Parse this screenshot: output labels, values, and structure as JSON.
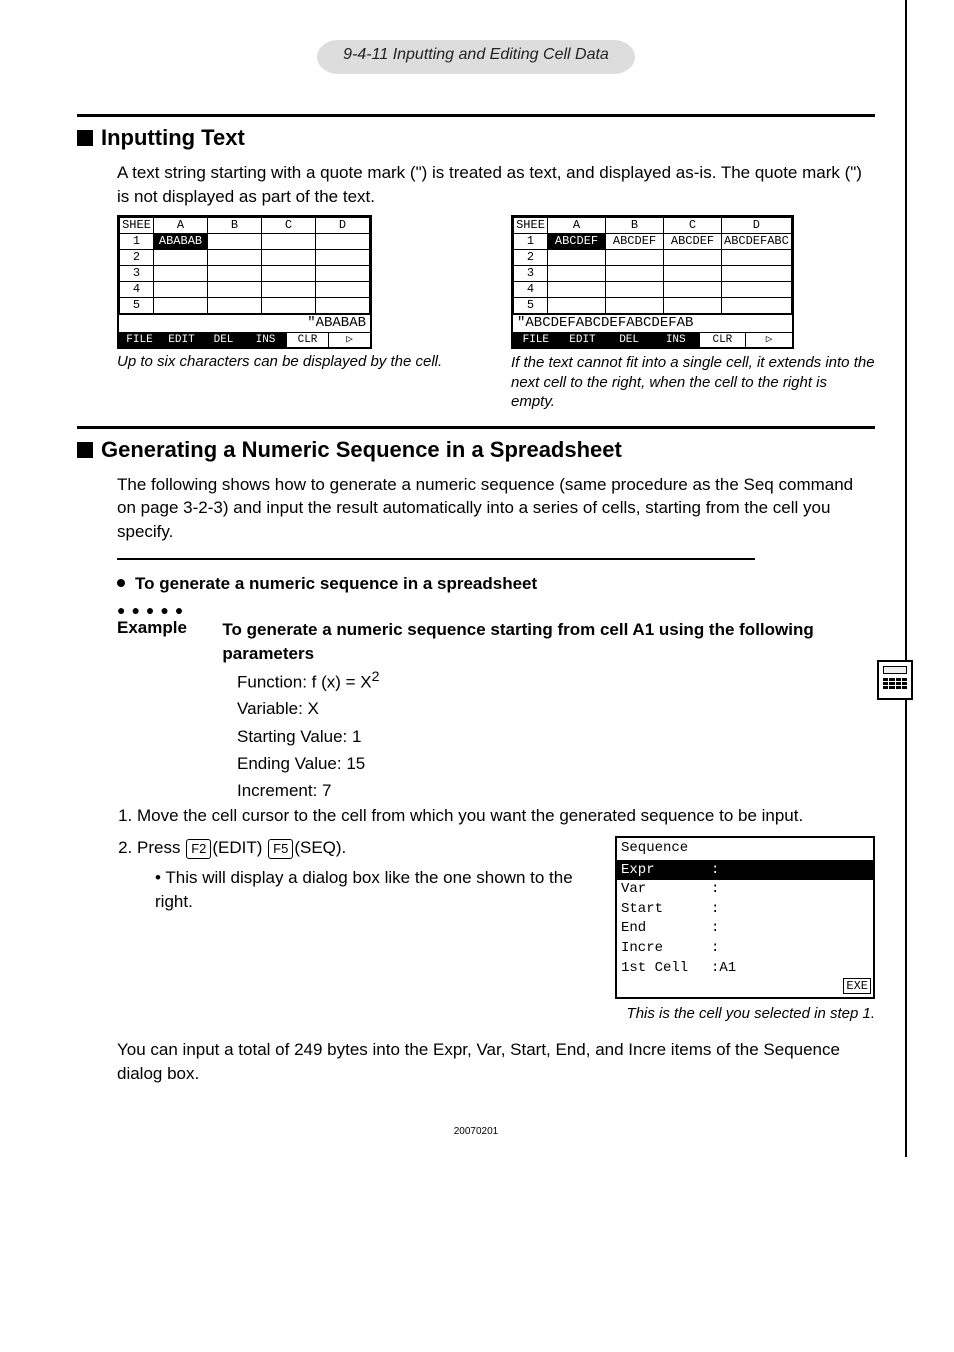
{
  "header": {
    "pagenum": "9-4-11",
    "title": "Inputting and Editing Cell Data"
  },
  "section1": {
    "heading": "Inputting Text",
    "body": "A text string starting with a quote mark (\") is treated as text, and displayed as-is. The quote mark (\") is not displayed as part of the text.",
    "sheetLabel": "SHEE",
    "cols": [
      "A",
      "B",
      "C",
      "D"
    ],
    "rows": [
      "1",
      "2",
      "3",
      "4",
      "5"
    ],
    "cellA1_left": "ABABAB",
    "inputline_left": "\"ABABAB",
    "caption_left": "Up to six characters can be displayed by the cell.",
    "cellrow_right": [
      "ABCDEF",
      "ABCDEF",
      "ABCDEF",
      "ABCDEFABC"
    ],
    "inputline_right": "\"ABCDEFABCDEFABCDEFAB",
    "caption_right": "If the text cannot fit into a single cell, it extends into the next cell to the right, when the cell to the right is empty.",
    "tabs": [
      "FILE",
      "EDIT",
      "DEL",
      "INS",
      "CLR",
      "▷"
    ]
  },
  "section2": {
    "heading": "Generating a Numeric Sequence in a Spreadsheet",
    "body": "The following shows how to generate a numeric sequence (same procedure as the Seq command on page 3-2-3) and input the result automatically into a series of cells, starting from the cell you specify."
  },
  "togen": {
    "sub": "To generate a numeric sequence in a spreadsheet",
    "exampleLabel": "Example",
    "exampleBody": "To generate a numeric sequence starting from cell A1 using the following parameters",
    "params": {
      "func": "Function: f (x) = X",
      "funcSup": "2",
      "var": "Variable: X",
      "start": "Starting Value: 1",
      "end": "Ending Value: 15",
      "incre": "Increment: 7"
    },
    "step1": "Move the cell cursor to the cell from which you want the generated sequence to be input.",
    "step2pre": "Press ",
    "step2keys": [
      "F2",
      "(EDIT)",
      "F5",
      "(SEQ)."
    ],
    "step2bullet": "This will display a dialog box like the one shown to the right.",
    "dialog": {
      "title": "Sequence",
      "rows": [
        {
          "lab": "Expr",
          "val": ":"
        },
        {
          "lab": "Var",
          "val": ":"
        },
        {
          "lab": "Start",
          "val": ":"
        },
        {
          "lab": "End",
          "val": ":"
        },
        {
          "lab": "Incre",
          "val": ":"
        },
        {
          "lab": "1st Cell",
          "val": ":A1"
        }
      ],
      "exe": "EXE"
    },
    "dialogCaption": "This is the cell you selected in step 1.",
    "tail": "You can input a total of 249 bytes into the Expr, Var, Start, End, and Incre items of the Sequence dialog box."
  },
  "footer": "20070201"
}
